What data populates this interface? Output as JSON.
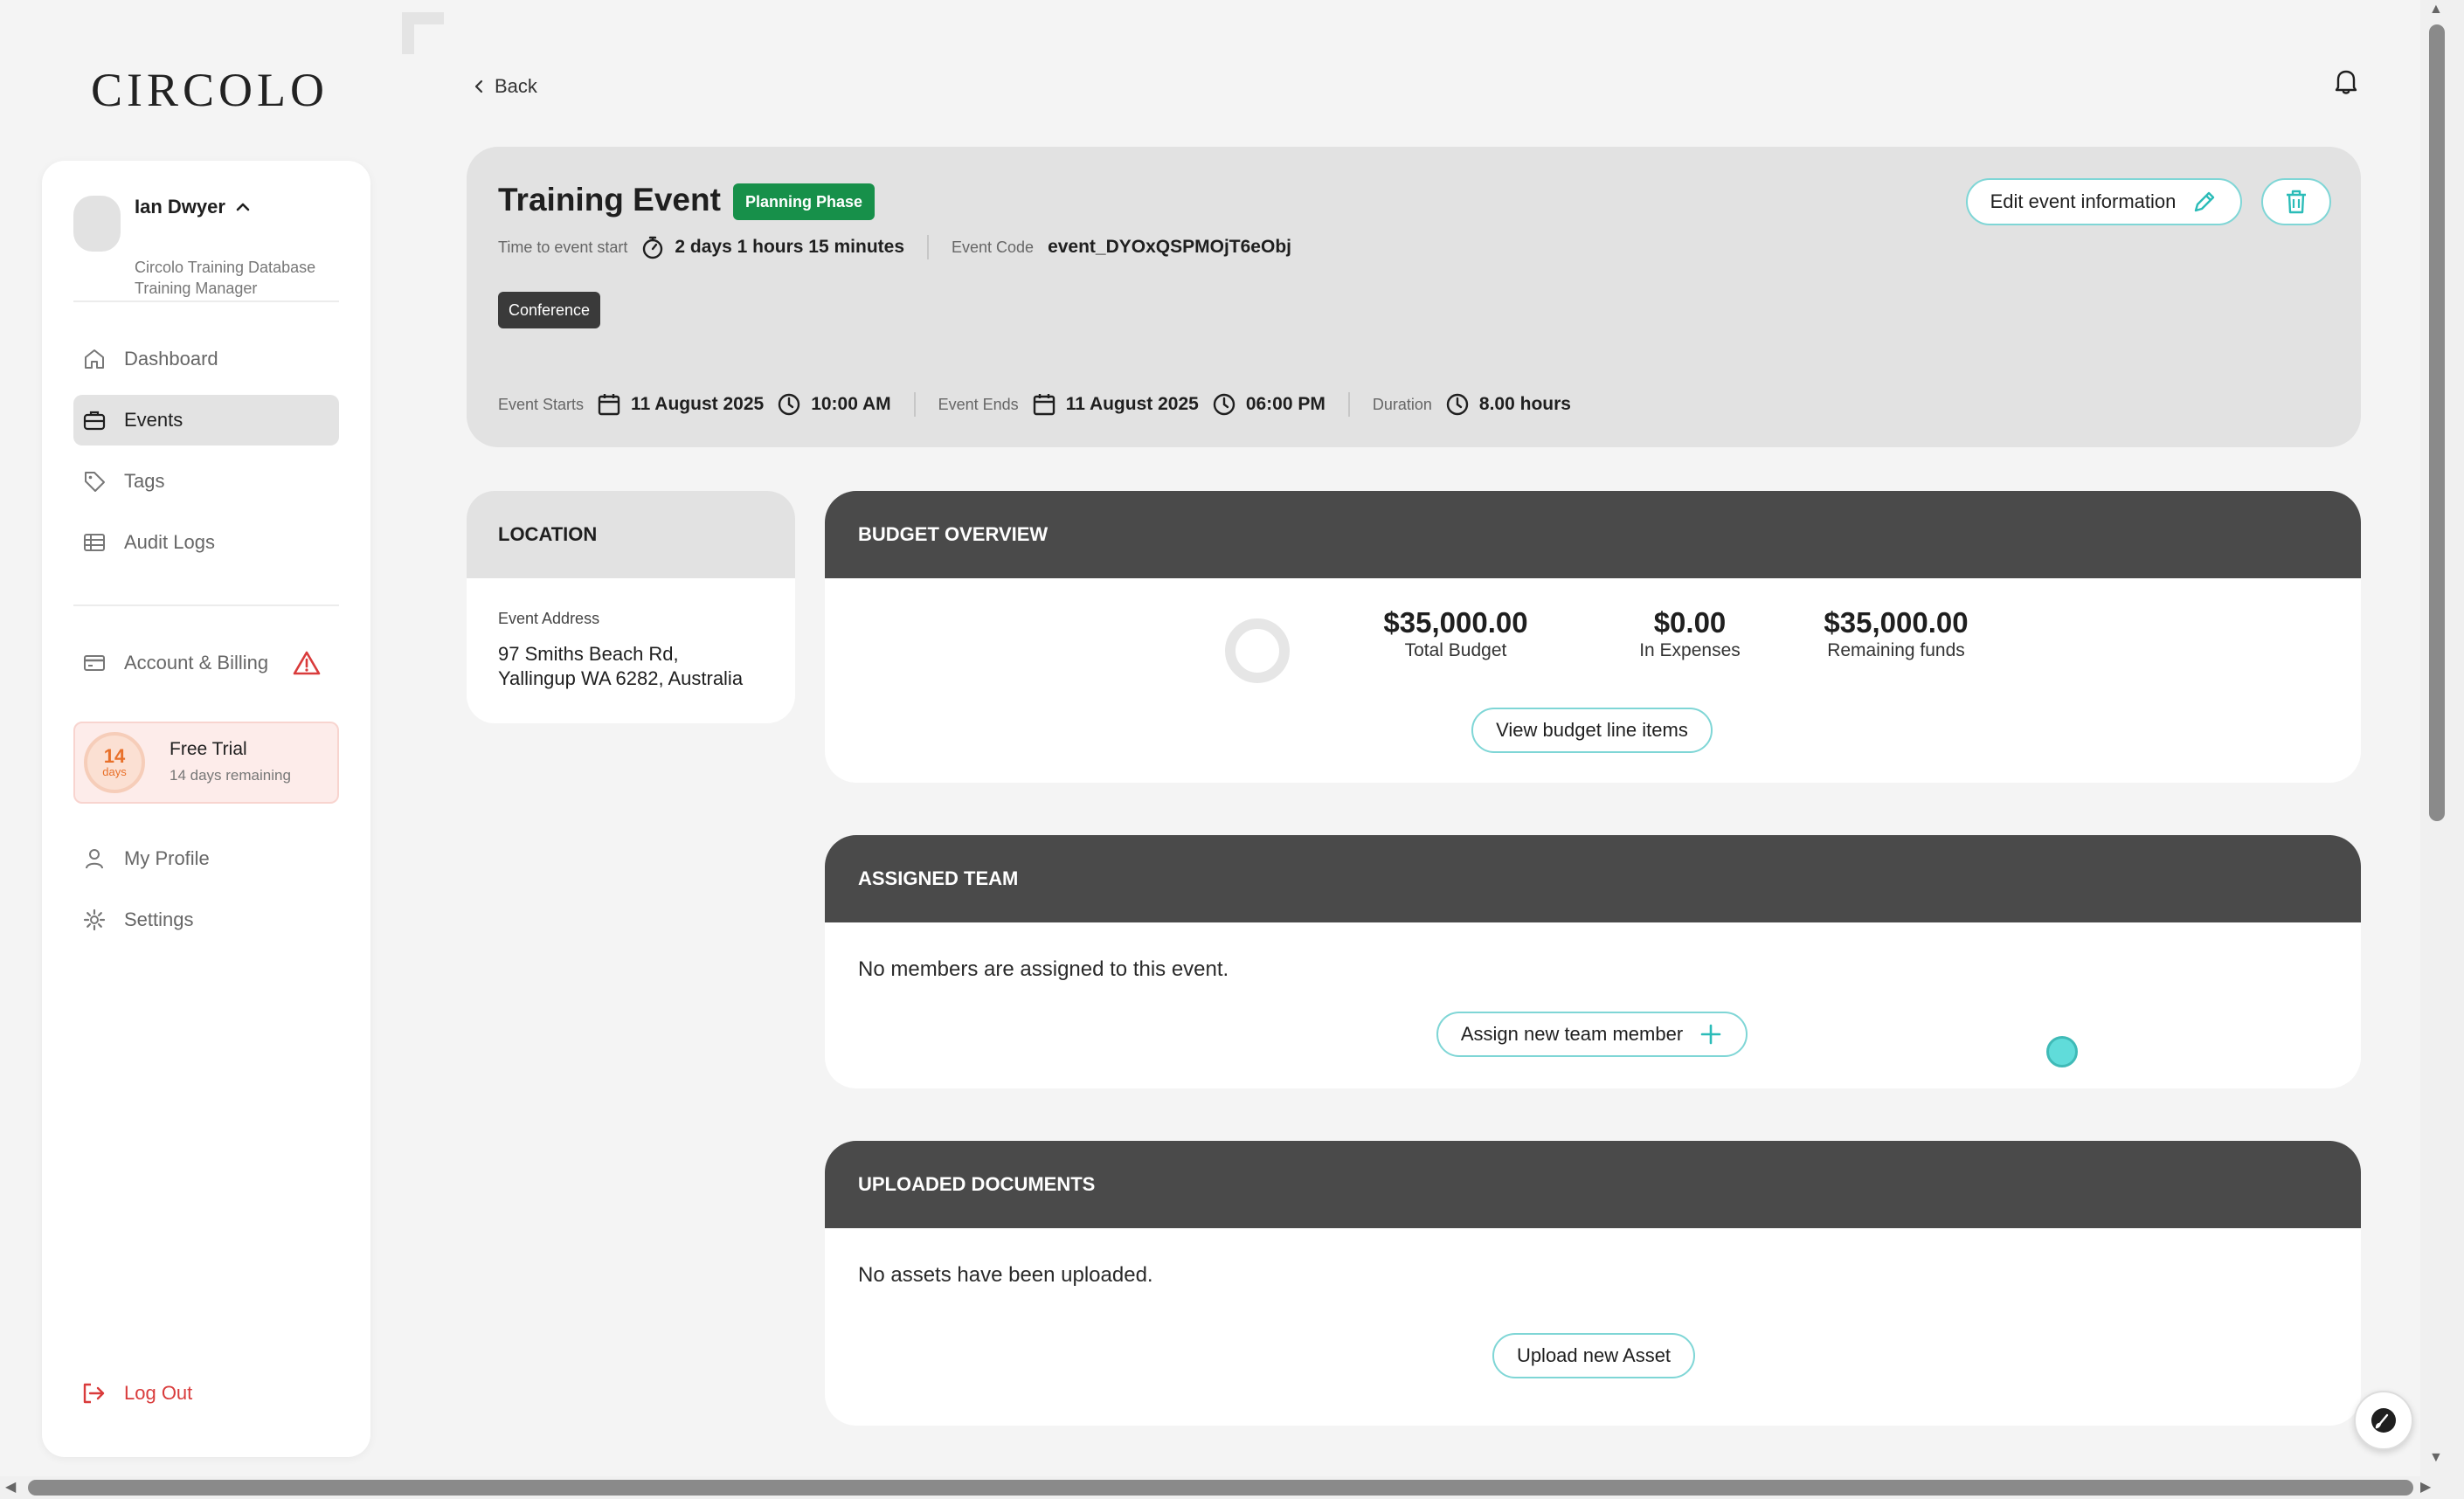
{
  "brand": {
    "logo_text": "CIRCOLO"
  },
  "user": {
    "name": "Ian Dwyer",
    "organization": "Circolo Training Database",
    "role": "Training Manager"
  },
  "nav": {
    "dashboard": "Dashboard",
    "events": "Events",
    "tags": "Tags",
    "audit_logs": "Audit Logs",
    "account_billing": "Account & Billing",
    "my_profile": "My Profile",
    "settings": "Settings",
    "log_out": "Log Out"
  },
  "trial": {
    "days_number": "14",
    "days_unit": "days",
    "title": "Free Trial",
    "subtitle": "14 days remaining"
  },
  "topbar": {
    "back_label": "Back"
  },
  "event": {
    "title": "Training Event",
    "phase": "Planning Phase",
    "time_to_start_label": "Time to event start",
    "time_to_start_value": "2 days 1 hours 15 minutes",
    "event_code_label": "Event Code",
    "event_code_value": "event_DYOxQSPMOjT6eObj",
    "tag": "Conference",
    "starts_label": "Event Starts",
    "starts_date": "11 August 2025",
    "starts_time": "10:00 AM",
    "ends_label": "Event Ends",
    "ends_date": "11 August 2025",
    "ends_time": "06:00 PM",
    "duration_label": "Duration",
    "duration_value": "8.00 hours",
    "edit_label": "Edit event information"
  },
  "location": {
    "heading": "LOCATION",
    "address_label": "Event Address",
    "address_line1": "97 Smiths Beach Rd,",
    "address_line2": "Yallingup WA 6282, Australia"
  },
  "budget": {
    "heading": "BUDGET OVERVIEW",
    "total_amount": "$35,000.00",
    "total_label": "Total Budget",
    "expenses_amount": "$0.00",
    "expenses_label": "In Expenses",
    "remaining_amount": "$35,000.00",
    "remaining_label": "Remaining funds",
    "spent_fraction": 0,
    "view_button": "View budget line items"
  },
  "team": {
    "heading": "ASSIGNED TEAM",
    "empty_text": "No members are assigned to this event.",
    "assign_button": "Assign new team member"
  },
  "documents": {
    "heading": "UPLOADED DOCUMENTS",
    "empty_text": "No assets have been uploaded.",
    "upload_button": "Upload new Asset"
  },
  "colors": {
    "accent": "#7fd6d6",
    "phase_green": "#17904a",
    "danger": "#d93b3b",
    "trial_orange": "#e8702a",
    "section_header": "#4a4a4a"
  },
  "icons": {
    "bell": "bell-icon",
    "home": "home-icon",
    "briefcase": "briefcase-icon",
    "tag": "tag-icon",
    "table": "table-icon",
    "card": "credit-card-icon",
    "warning": "warning-icon",
    "user": "user-icon",
    "gear": "gear-icon",
    "logout": "logout-icon",
    "stopwatch": "stopwatch-icon",
    "calendar": "calendar-icon",
    "clock": "clock-icon",
    "pencil": "pencil-icon",
    "trash": "trash-icon",
    "plus": "plus-icon",
    "chevron_left": "chevron-left-icon",
    "chevron_up": "chevron-up-icon",
    "brush": "brush-icon"
  }
}
